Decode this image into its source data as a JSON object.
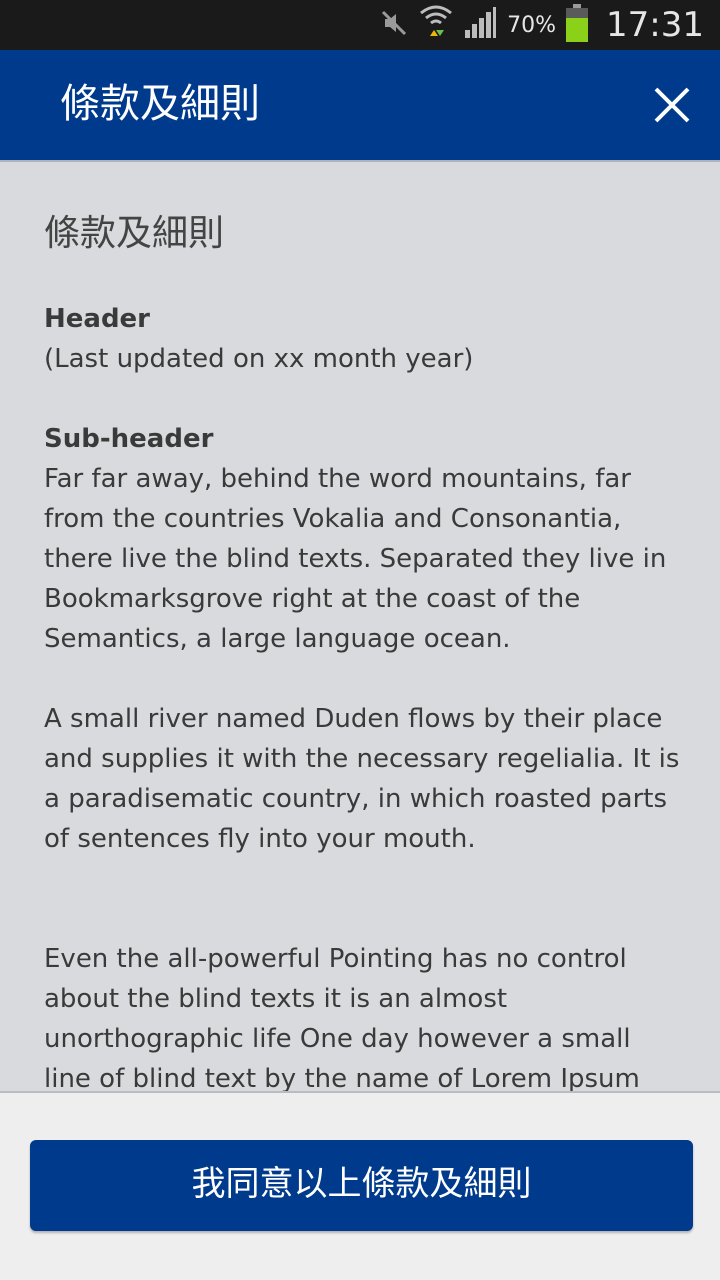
{
  "status_bar": {
    "battery_percent": "70%",
    "time": "17:31",
    "icons": [
      "mute-icon",
      "wifi-icon",
      "signal-icon",
      "battery-icon"
    ]
  },
  "app_bar": {
    "title": "條款及細則",
    "close_icon": "close-icon"
  },
  "content": {
    "heading": "條款及細則",
    "header_label": "Header",
    "last_updated": "(Last updated on xx month year)",
    "subheader_label": "Sub-header",
    "paragraph_1": "Far far away, behind the word mountains, far from the countries Vokalia and Consonantia, there live the blind texts. Separated they live in Bookmarksgrove right at the coast of the Semantics, a large language ocean.",
    "paragraph_2": "A small river named Duden flows by their place and supplies it with the necessary regelialia. It is a paradisematic country, in which roasted parts of sentences fly into your mouth.",
    "paragraph_3": "Even the all-powerful Pointing has no control about the blind texts it is an almost unorthographic life One day however a small line of blind text by the name of Lorem Ipsum"
  },
  "footer": {
    "agree_button": "我同意以上條款及細則"
  },
  "colors": {
    "app_bar": "#003a8c",
    "background": "#d9dadd",
    "footer": "#eeeeef",
    "status_bar": "#1a1a1a"
  }
}
